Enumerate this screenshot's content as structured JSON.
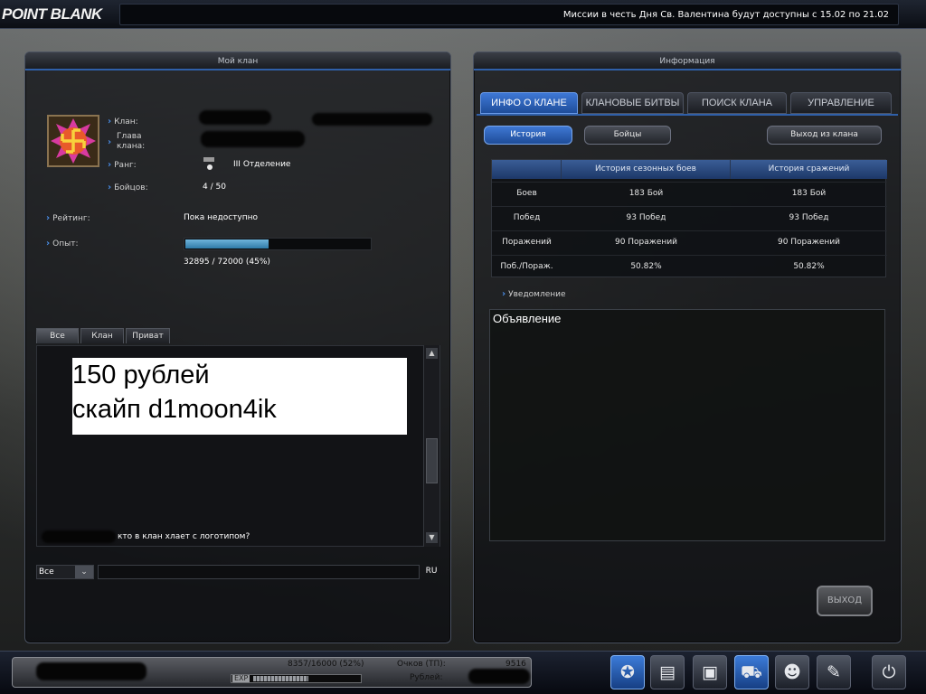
{
  "header": {
    "logo": "POINT BLANK",
    "ticker": "Миссии в честь Дня Св. Валентина будут доступны с 15.02 по 21.02"
  },
  "left_panel": {
    "title": "Мой клан",
    "clan_label": "Клан:",
    "leader_label_1": "Глава",
    "leader_label_2": "клана:",
    "rank_label": "Ранг:",
    "rank_value": "III Отделение",
    "members_label": "Бойцов:",
    "members_value": "4 / 50",
    "rating_label": "Рейтинг:",
    "rating_value": "Пока недоступно",
    "exp_label": "Опыт:",
    "exp_value": "32895 / 72000 (45%)",
    "exp_progress": 0.45
  },
  "chat": {
    "tabs": [
      "Все",
      "Клан",
      "Приват"
    ],
    "ad_line1": " 150 рублей",
    "ad_line2": "скайп d1moon4ik",
    "message": "кто в клан хлает с логотипом?",
    "channel": "Все",
    "lang": "RU"
  },
  "right_panel": {
    "title": "Информация",
    "tabs": [
      "ИНФО О КЛАНЕ",
      "КЛАНОВЫЕ БИТВЫ",
      "ПОИСК КЛАНА",
      "УПРАВЛЕНИЕ"
    ],
    "buttons": {
      "history": "История",
      "fighters": "Бойцы",
      "leave": "Выход из клана"
    },
    "table": {
      "headers": [
        "",
        "История сезонных боев",
        "История сражений"
      ],
      "rows": [
        [
          "Боев",
          "183  Бой",
          "183  Бой"
        ],
        [
          "Побед",
          "93 Побед",
          "93 Побед"
        ],
        [
          "Поражений",
          "90 Поражений",
          "90 Поражений"
        ],
        [
          "Поб./Пораж.",
          "50.82%",
          "50.82%"
        ]
      ]
    },
    "notice_label": "Уведомление",
    "notice_text": "Объявление",
    "exit_button": "ВЫХОД"
  },
  "bottom": {
    "exp_text": "8357/16000 (52%)",
    "exp_tag": "EXP",
    "exp_progress": 0.52,
    "points_label": "Очков (ТП):",
    "points_value": "9516",
    "rubles_label": "Рублей:",
    "dock_icons": [
      "clan-emblem-icon",
      "inventory-icon",
      "shop-bag-icon",
      "cart-icon",
      "friends-icon",
      "settings-wrench-icon",
      "power-icon"
    ]
  }
}
